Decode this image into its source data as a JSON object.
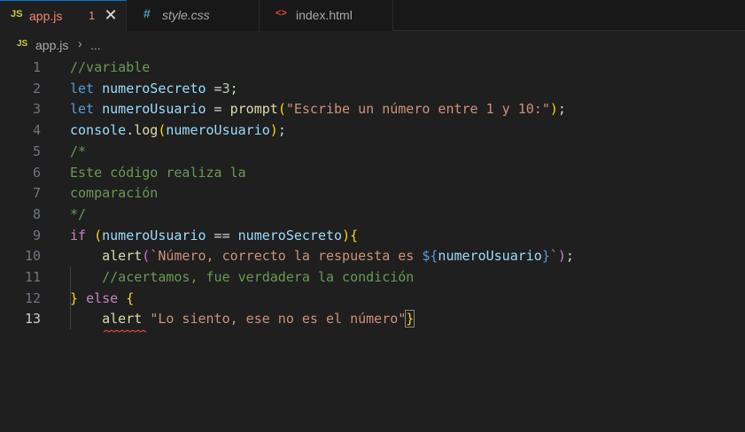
{
  "tabs": [
    {
      "icon": "JS",
      "label": "app.js",
      "badge": "1",
      "close": "✕",
      "active": true
    },
    {
      "icon": "#",
      "label": "style.css",
      "active": false
    },
    {
      "icon": "<>",
      "label": "index.html",
      "active": false
    }
  ],
  "breadcrumb": {
    "icon": "JS",
    "file": "app.js",
    "separator": "›",
    "more": "..."
  },
  "colors": {
    "js_icon": "#cbcb41",
    "css_icon": "#519aba",
    "html_icon": "#e44d26",
    "active_tab_text": "#f48771",
    "error_badge": "#f48771",
    "accent": "#0078d4"
  },
  "lines": [
    {
      "n": "1",
      "tokens": [
        [
          "c",
          "//variable"
        ]
      ]
    },
    {
      "n": "2",
      "tokens": [
        [
          "k",
          "let"
        ],
        [
          "p",
          " "
        ],
        [
          "v",
          "numeroSecreto"
        ],
        [
          "p",
          " ="
        ],
        [
          "n",
          "3"
        ],
        [
          "p",
          ";"
        ]
      ]
    },
    {
      "n": "3",
      "tokens": [
        [
          "k",
          "let"
        ],
        [
          "p",
          " "
        ],
        [
          "v",
          "numeroUsuario"
        ],
        [
          "p",
          " = "
        ],
        [
          "f",
          "prompt"
        ],
        [
          "b1",
          "("
        ],
        [
          "s",
          "\"Escribe un número entre 1 y 10:\""
        ],
        [
          "b1",
          ")"
        ],
        [
          "p",
          ";"
        ]
      ]
    },
    {
      "n": "4",
      "tokens": [
        [
          "v",
          "console"
        ],
        [
          "p",
          "."
        ],
        [
          "f",
          "log"
        ],
        [
          "b1",
          "("
        ],
        [
          "v",
          "numeroUsuario"
        ],
        [
          "b1",
          ")"
        ],
        [
          "p",
          ";"
        ]
      ]
    },
    {
      "n": "5",
      "tokens": [
        [
          "c",
          "/*"
        ]
      ]
    },
    {
      "n": "6",
      "tokens": [
        [
          "c",
          "Este código realiza la"
        ]
      ]
    },
    {
      "n": "7",
      "tokens": [
        [
          "c",
          "comparación"
        ]
      ]
    },
    {
      "n": "8",
      "tokens": [
        [
          "c",
          "*/"
        ]
      ]
    },
    {
      "n": "9",
      "tokens": [
        [
          "x",
          "if"
        ],
        [
          "p",
          " "
        ],
        [
          "b1",
          "("
        ],
        [
          "v",
          "numeroUsuario"
        ],
        [
          "p",
          " == "
        ],
        [
          "v",
          "numeroSecreto"
        ],
        [
          "b1",
          ")"
        ],
        [
          "b1",
          "{"
        ]
      ]
    },
    {
      "n": "10",
      "tokens": [
        [
          "p",
          "    "
        ],
        [
          "f",
          "alert"
        ],
        [
          "b2",
          "("
        ],
        [
          "s",
          "`Número, correcto la respuesta es "
        ],
        [
          "k",
          "${"
        ],
        [
          "v",
          "numeroUsuario"
        ],
        [
          "k",
          "}"
        ],
        [
          "s",
          "`"
        ],
        [
          "b2",
          ")"
        ],
        [
          "p",
          ";"
        ]
      ]
    },
    {
      "n": "11",
      "tokens": [
        [
          "p",
          "    "
        ],
        [
          "c",
          "//acertamos, fue verdadera la condición"
        ]
      ]
    },
    {
      "n": "12",
      "tokens": [
        [
          "b1",
          "}"
        ],
        [
          "p",
          " "
        ],
        [
          "x",
          "else"
        ],
        [
          "p",
          " "
        ],
        [
          "b1",
          "{"
        ]
      ]
    },
    {
      "n": "13",
      "tokens": [
        [
          "p",
          "    "
        ],
        [
          "f",
          "alert"
        ],
        [
          "p",
          " "
        ],
        [
          "s",
          "\"Lo siento, ese no es el número\""
        ],
        [
          "bc",
          "}"
        ]
      ],
      "current": true
    }
  ]
}
